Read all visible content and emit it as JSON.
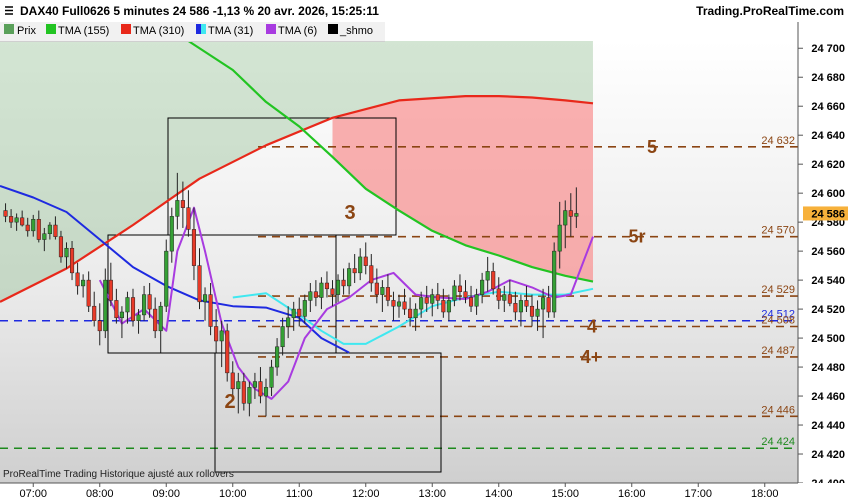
{
  "header": {
    "title": "DAX40 Full0626 5 minutes 24 586 -1,13 % 20 avr. 2026, 15:25:11",
    "brand": "Trading.ProRealTime.com"
  },
  "legend": [
    {
      "label": "Prix",
      "color": "#5aa05a"
    },
    {
      "label": "TMA (155)",
      "color": "#22c422"
    },
    {
      "label": "TMA (310)",
      "color": "#e8281a"
    },
    {
      "label": "TMA (31)",
      "color": "#1e2ae0"
    },
    {
      "label": "TMA (6)",
      "color": "#a83be0"
    },
    {
      "label": "_shmo",
      "color": "#000000"
    }
  ],
  "footer": "ProRealTime Trading  Historique ajusté aux rollovers",
  "colors": {
    "up_candle": "#35a035",
    "down_candle": "#e83a28",
    "tma155": "#22c422",
    "tma310": "#e8281a",
    "tma31": "#1e2ae0",
    "tma31_cyan": "#40e8f0",
    "tma6": "#a83be0",
    "level_line": "#8b4513",
    "blue_line": "#1e2ae0",
    "green_line": "#1e8a1e",
    "price_box": "#f7b13b"
  },
  "chart_data": {
    "type": "candlestick",
    "title": "DAX40 Full0626 5 minutes",
    "ylim": [
      24400,
      24705
    ],
    "xlim": [
      "06:30",
      "18:30"
    ],
    "x_ticks": [
      "07:00",
      "08:00",
      "09:00",
      "10:00",
      "11:00",
      "12:00",
      "13:00",
      "14:00",
      "15:00",
      "16:00",
      "17:00",
      "18:00"
    ],
    "y_ticks": [
      24400,
      24420,
      24440,
      24460,
      24480,
      24500,
      24520,
      24540,
      24560,
      24580,
      24600,
      24620,
      24640,
      24660,
      24680,
      24700
    ],
    "current_price": 24586,
    "levels": [
      {
        "value": 24632,
        "label": "24 632",
        "marker": "5",
        "style": "dashed",
        "color": "#8b4513"
      },
      {
        "value": 24570,
        "label": "24 570",
        "marker": "5r",
        "style": "dashed",
        "color": "#8b4513"
      },
      {
        "value": 24529,
        "label": "24 529",
        "marker": "",
        "style": "dashed",
        "color": "#8b4513"
      },
      {
        "value": 24512,
        "label": "24 512",
        "marker": "",
        "style": "dashed",
        "color": "#1e2ae0"
      },
      {
        "value": 24508,
        "label": "24 508",
        "marker": "4",
        "style": "dashed",
        "color": "#8b4513"
      },
      {
        "value": 24487,
        "label": "24 487",
        "marker": "4+",
        "style": "dashed",
        "color": "#8b4513"
      },
      {
        "value": 24446,
        "label": "24 446",
        "marker": "",
        "style": "dashed",
        "color": "#8b4513"
      },
      {
        "value": 24424,
        "label": "24 424",
        "marker": "",
        "style": "dashed",
        "color": "#1e8a1e"
      }
    ],
    "wave_labels": [
      "2",
      "3"
    ],
    "series": [
      {
        "name": "TMA (310)",
        "points": [
          [
            "06:30",
            24525
          ],
          [
            "07:30",
            24548
          ],
          [
            "08:30",
            24578
          ],
          [
            "09:30",
            24610
          ],
          [
            "10:30",
            24633
          ],
          [
            "11:30",
            24652
          ],
          [
            "12:30",
            24664
          ],
          [
            "13:30",
            24667
          ],
          [
            "14:00",
            24667
          ],
          [
            "14:30",
            24666
          ],
          [
            "15:00",
            24664
          ],
          [
            "15:25",
            24662
          ]
        ]
      },
      {
        "name": "TMA (155)",
        "points": [
          [
            "09:20",
            24705
          ],
          [
            "10:00",
            24685
          ],
          [
            "10:30",
            24663
          ],
          [
            "11:00",
            24646
          ],
          [
            "11:30",
            24625
          ],
          [
            "12:00",
            24603
          ],
          [
            "12:30",
            24588
          ],
          [
            "13:00",
            24574
          ],
          [
            "13:30",
            24564
          ],
          [
            "14:00",
            24557
          ],
          [
            "14:30",
            24549
          ],
          [
            "15:00",
            24543
          ],
          [
            "15:25",
            24539
          ]
        ]
      },
      {
        "name": "TMA (31)",
        "points": [
          [
            "06:30",
            24605
          ],
          [
            "07:00",
            24597
          ],
          [
            "07:30",
            24587
          ],
          [
            "08:00",
            24568
          ],
          [
            "08:30",
            24549
          ],
          [
            "09:00",
            24536
          ],
          [
            "09:30",
            24526
          ],
          [
            "10:00",
            24522
          ],
          [
            "10:30",
            24521
          ],
          [
            "11:00",
            24514
          ],
          [
            "11:20",
            24500
          ],
          [
            "11:45",
            24490
          ]
        ]
      },
      {
        "name": "TMA (31) cyan",
        "points": [
          [
            "10:00",
            24528
          ],
          [
            "10:30",
            24531
          ],
          [
            "11:00",
            24516
          ],
          [
            "11:20",
            24505
          ],
          [
            "11:40",
            24496
          ],
          [
            "12:00",
            24496
          ],
          [
            "12:30",
            24508
          ],
          [
            "13:00",
            24522
          ],
          [
            "13:30",
            24528
          ],
          [
            "14:00",
            24532
          ],
          [
            "14:30",
            24530
          ],
          [
            "15:00",
            24530
          ],
          [
            "15:25",
            24534
          ]
        ]
      },
      {
        "name": "TMA (6)",
        "points": [
          [
            "08:00",
            24540
          ],
          [
            "08:20",
            24510
          ],
          [
            "08:40",
            24520
          ],
          [
            "09:00",
            24505
          ],
          [
            "09:10",
            24560
          ],
          [
            "09:25",
            24590
          ],
          [
            "09:35",
            24560
          ],
          [
            "09:50",
            24510
          ],
          [
            "10:05",
            24480
          ],
          [
            "10:20",
            24465
          ],
          [
            "10:35",
            24458
          ],
          [
            "10:50",
            24470
          ],
          [
            "11:05",
            24500
          ],
          [
            "11:25",
            24520
          ],
          [
            "11:45",
            24528
          ],
          [
            "12:05",
            24540
          ],
          [
            "12:25",
            24545
          ],
          [
            "12:45",
            24530
          ],
          [
            "13:05",
            24528
          ],
          [
            "13:30",
            24527
          ],
          [
            "13:50",
            24532
          ],
          [
            "14:10",
            24540
          ],
          [
            "14:30",
            24535
          ],
          [
            "14:50",
            24528
          ],
          [
            "15:05",
            24530
          ],
          [
            "15:15",
            24550
          ],
          [
            "15:25",
            24570
          ]
        ]
      }
    ],
    "candles": [
      [
        "06:35",
        24588,
        24593,
        24580,
        24584
      ],
      [
        "06:40",
        24584,
        24589,
        24576,
        24580
      ],
      [
        "06:45",
        24580,
        24586,
        24574,
        24583
      ],
      [
        "06:50",
        24583,
        24588,
        24577,
        24578
      ],
      [
        "06:55",
        24578,
        24583,
        24570,
        24574
      ],
      [
        "07:00",
        24574,
        24585,
        24570,
        24582
      ],
      [
        "07:05",
        24582,
        24588,
        24566,
        24568
      ],
      [
        "07:10",
        24568,
        24576,
        24560,
        24572
      ],
      [
        "07:15",
        24572,
        24580,
        24568,
        24578
      ],
      [
        "07:20",
        24578,
        24584,
        24568,
        24570
      ],
      [
        "07:25",
        24570,
        24574,
        24552,
        24556
      ],
      [
        "07:30",
        24556,
        24566,
        24548,
        24562
      ],
      [
        "07:35",
        24562,
        24567,
        24540,
        24545
      ],
      [
        "07:40",
        24545,
        24552,
        24530,
        24536
      ],
      [
        "07:45",
        24536,
        24544,
        24528,
        24540
      ],
      [
        "07:50",
        24540,
        24546,
        24518,
        24522
      ],
      [
        "07:55",
        24522,
        24532,
        24508,
        24512
      ],
      [
        "08:00",
        24512,
        24524,
        24495,
        24505
      ],
      [
        "08:05",
        24505,
        24548,
        24500,
        24540
      ],
      [
        "08:10",
        24540,
        24552,
        24522,
        24526
      ],
      [
        "08:15",
        24526,
        24534,
        24510,
        24514
      ],
      [
        "08:20",
        24514,
        24522,
        24500,
        24518
      ],
      [
        "08:25",
        24518,
        24532,
        24510,
        24528
      ],
      [
        "08:30",
        24528,
        24534,
        24508,
        24512
      ],
      [
        "08:35",
        24512,
        24520,
        24503,
        24516
      ],
      [
        "08:40",
        24516,
        24536,
        24512,
        24530
      ],
      [
        "08:45",
        24530,
        24538,
        24514,
        24520
      ],
      [
        "08:50",
        24520,
        24528,
        24500,
        24505
      ],
      [
        "08:55",
        24505,
        24525,
        24490,
        24522
      ],
      [
        "09:00",
        24522,
        24568,
        24518,
        24560
      ],
      [
        "09:05",
        24560,
        24590,
        24552,
        24584
      ],
      [
        "09:10",
        24584,
        24614,
        24575,
        24595
      ],
      [
        "09:15",
        24595,
        24608,
        24576,
        24590
      ],
      [
        "09:20",
        24590,
        24602,
        24570,
        24575
      ],
      [
        "09:25",
        24575,
        24590,
        24540,
        24550
      ],
      [
        "09:30",
        24550,
        24562,
        24520,
        24525
      ],
      [
        "09:35",
        24525,
        24535,
        24512,
        24530
      ],
      [
        "09:40",
        24530,
        24538,
        24502,
        24508
      ],
      [
        "09:45",
        24508,
        24520,
        24490,
        24498
      ],
      [
        "09:50",
        24498,
        24512,
        24480,
        24505
      ],
      [
        "09:55",
        24505,
        24510,
        24470,
        24476
      ],
      [
        "10:00",
        24476,
        24484,
        24460,
        24465
      ],
      [
        "10:05",
        24465,
        24476,
        24448,
        24470
      ],
      [
        "10:10",
        24470,
        24476,
        24450,
        24455
      ],
      [
        "10:15",
        24455,
        24470,
        24446,
        24466
      ],
      [
        "10:20",
        24466,
        24476,
        24458,
        24470
      ],
      [
        "10:25",
        24470,
        24480,
        24455,
        24460
      ],
      [
        "10:30",
        24460,
        24472,
        24446,
        24466
      ],
      [
        "10:35",
        24466,
        24485,
        24460,
        24480
      ],
      [
        "10:40",
        24480,
        24500,
        24474,
        24494
      ],
      [
        "10:45",
        24494,
        24514,
        24488,
        24508
      ],
      [
        "10:50",
        24508,
        24522,
        24500,
        24514
      ],
      [
        "10:55",
        24514,
        24525,
        24505,
        24520
      ],
      [
        "11:00",
        24520,
        24528,
        24508,
        24515
      ],
      [
        "11:05",
        24515,
        24530,
        24510,
        24526
      ],
      [
        "11:10",
        24526,
        24538,
        24518,
        24532
      ],
      [
        "11:15",
        24532,
        24540,
        24522,
        24528
      ],
      [
        "11:20",
        24528,
        24542,
        24520,
        24538
      ],
      [
        "11:25",
        24538,
        24546,
        24528,
        24534
      ],
      [
        "11:30",
        24534,
        24540,
        24522,
        24530
      ],
      [
        "11:35",
        24530,
        24544,
        24525,
        24540
      ],
      [
        "11:40",
        24540,
        24548,
        24530,
        24536
      ],
      [
        "11:45",
        24536,
        24552,
        24530,
        24548
      ],
      [
        "11:50",
        24548,
        24558,
        24538,
        24545
      ],
      [
        "11:55",
        24545,
        24562,
        24540,
        24556
      ],
      [
        "12:00",
        24556,
        24566,
        24544,
        24550
      ],
      [
        "12:05",
        24550,
        24558,
        24532,
        24538
      ],
      [
        "12:10",
        24538,
        24548,
        24524,
        24530
      ],
      [
        "12:15",
        24530,
        24540,
        24518,
        24535
      ],
      [
        "12:20",
        24535,
        24544,
        24522,
        24526
      ],
      [
        "12:25",
        24526,
        24532,
        24512,
        24522
      ],
      [
        "12:30",
        24522,
        24530,
        24514,
        24525
      ],
      [
        "12:35",
        24525,
        24534,
        24516,
        24520
      ],
      [
        "12:40",
        24520,
        24528,
        24508,
        24514
      ],
      [
        "12:45",
        24514,
        24524,
        24505,
        24520
      ],
      [
        "12:50",
        24520,
        24532,
        24514,
        24528
      ],
      [
        "12:55",
        24528,
        24536,
        24518,
        24524
      ],
      [
        "13:00",
        24524,
        24534,
        24515,
        24530
      ],
      [
        "13:05",
        24530,
        24538,
        24520,
        24526
      ],
      [
        "13:10",
        24526,
        24534,
        24514,
        24518
      ],
      [
        "13:15",
        24518,
        24530,
        24512,
        24526
      ],
      [
        "13:20",
        24526,
        24540,
        24522,
        24536
      ],
      [
        "13:25",
        24536,
        24544,
        24526,
        24532
      ],
      [
        "13:30",
        24532,
        24540,
        24524,
        24528
      ],
      [
        "13:35",
        24528,
        24536,
        24518,
        24522
      ],
      [
        "13:40",
        24522,
        24534,
        24516,
        24530
      ],
      [
        "13:45",
        24530,
        24545,
        24524,
        24540
      ],
      [
        "13:50",
        24540,
        24556,
        24532,
        24546
      ],
      [
        "13:55",
        24546,
        24552,
        24530,
        24534
      ],
      [
        "14:00",
        24534,
        24542,
        24520,
        24526
      ],
      [
        "14:05",
        24526,
        24536,
        24518,
        24530
      ],
      [
        "14:10",
        24530,
        24540,
        24522,
        24524
      ],
      [
        "14:15",
        24524,
        24532,
        24512,
        24518
      ],
      [
        "14:20",
        24518,
        24530,
        24508,
        24526
      ],
      [
        "14:25",
        24526,
        24536,
        24518,
        24522
      ],
      [
        "14:30",
        24522,
        24530,
        24508,
        24515
      ],
      [
        "14:35",
        24515,
        24526,
        24505,
        24520
      ],
      [
        "14:40",
        24520,
        24534,
        24500,
        24528
      ],
      [
        "14:45",
        24528,
        24536,
        24514,
        24518
      ],
      [
        "14:50",
        24518,
        24566,
        24514,
        24560
      ],
      [
        "14:55",
        24560,
        24594,
        24548,
        24578
      ],
      [
        "15:00",
        24578,
        24595,
        24562,
        24588
      ],
      [
        "15:05",
        24588,
        24600,
        24570,
        24584
      ],
      [
        "15:10",
        24584,
        24604,
        24576,
        24586
      ]
    ]
  }
}
